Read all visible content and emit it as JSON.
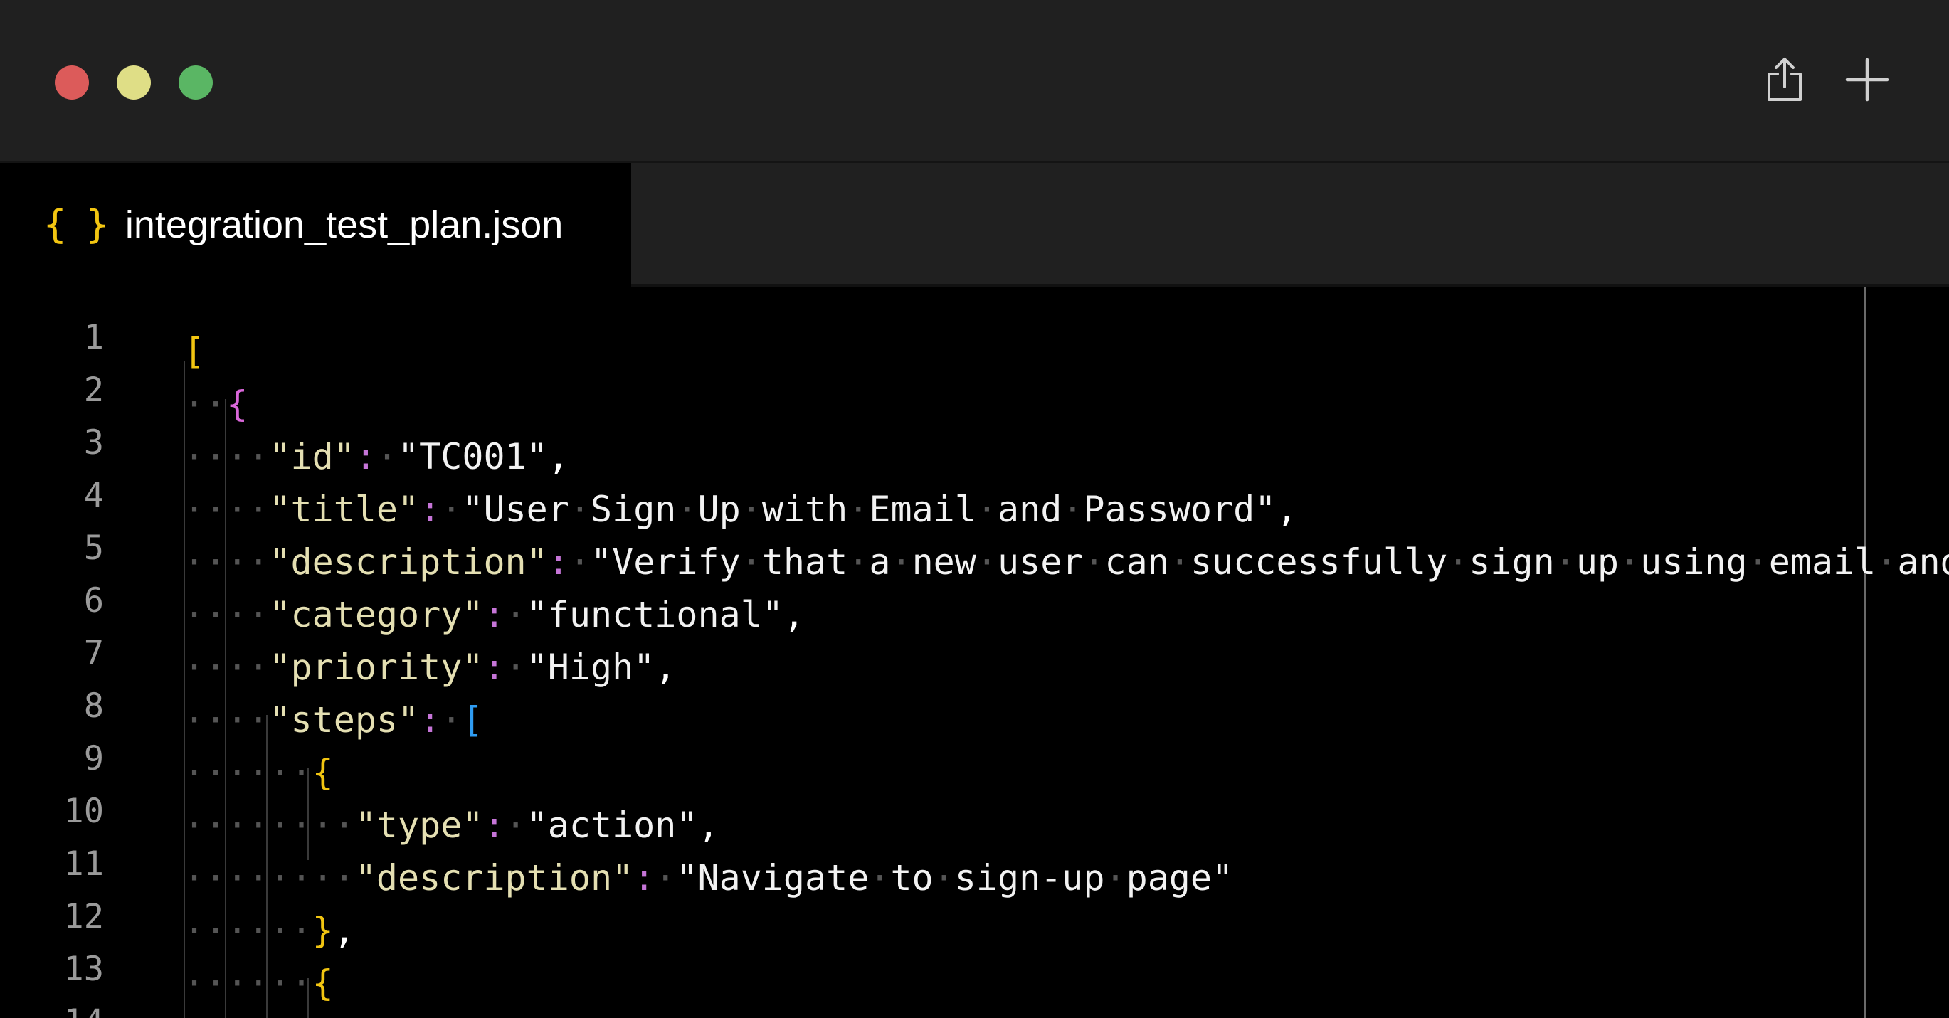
{
  "window": {
    "traffic_lights": [
      {
        "name": "close",
        "color": "#dc5b5a"
      },
      {
        "name": "minimize",
        "color": "#dfde86"
      },
      {
        "name": "maximize",
        "color": "#5ab664"
      }
    ],
    "toolbar": {
      "share_icon": "share-icon",
      "add_icon": "plus-icon"
    }
  },
  "tab": {
    "icon": "{ }",
    "label": "integration_test_plan.json"
  },
  "editor": {
    "line_numbers": [
      "1",
      "2",
      "3",
      "4",
      "5",
      "6",
      "7",
      "8",
      "9",
      "10",
      "11",
      "12",
      "13",
      "14"
    ],
    "colors": {
      "key": "#e4dfb2",
      "colon": "#c675d8",
      "bracket_level1": "#f2c511",
      "bracket_level2": "#da67da",
      "bracket_level3": "#2f9cf2"
    }
  }
}
